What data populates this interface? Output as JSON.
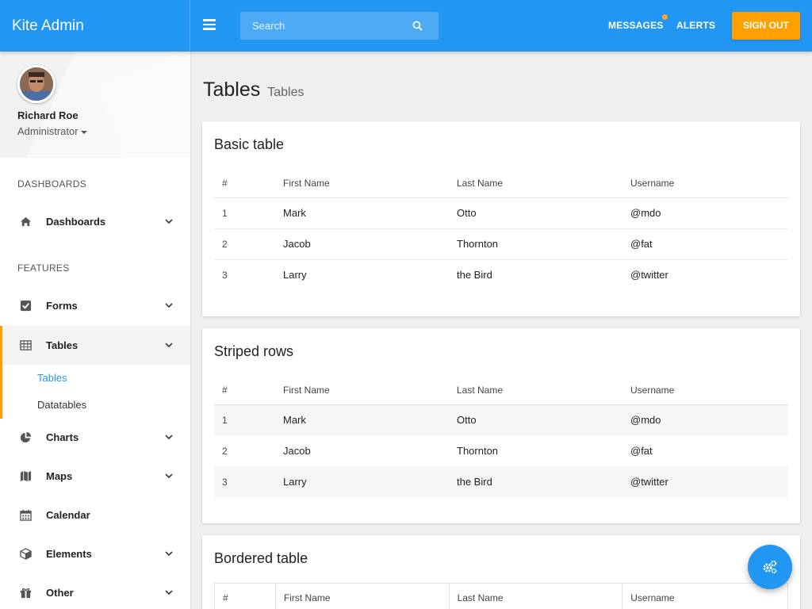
{
  "app": {
    "title": "Kite Admin"
  },
  "header": {
    "search_placeholder": "Search",
    "nav": {
      "messages": "MESSAGES",
      "alerts": "ALERTS",
      "sign_out": "SIGN OUT"
    }
  },
  "profile": {
    "name": "Richard Roe",
    "role": "Administrator"
  },
  "sidebar": {
    "sections": {
      "dashboards": "DASHBOARDS",
      "features": "FEATURES"
    },
    "items": {
      "dashboards": "Dashboards",
      "forms": "Forms",
      "tables": "Tables",
      "charts": "Charts",
      "maps": "Maps",
      "calendar": "Calendar",
      "elements": "Elements",
      "other": "Other"
    },
    "subitems": {
      "tables": "Tables",
      "datatables": "Datatables"
    }
  },
  "page": {
    "title": "Tables",
    "subtitle": "Tables"
  },
  "columns": [
    "#",
    "First Name",
    "Last Name",
    "Username"
  ],
  "rows": [
    [
      "1",
      "Mark",
      "Otto",
      "@mdo"
    ],
    [
      "2",
      "Jacob",
      "Thornton",
      "@fat"
    ],
    [
      "3",
      "Larry",
      "the Bird",
      "@twitter"
    ]
  ],
  "cards": {
    "basic": {
      "title": "Basic table"
    },
    "striped": {
      "title": "Striped rows"
    },
    "bordered": {
      "title": "Bordered table"
    }
  },
  "colors": {
    "primary": "#2196f3",
    "accent": "#ffa000"
  }
}
